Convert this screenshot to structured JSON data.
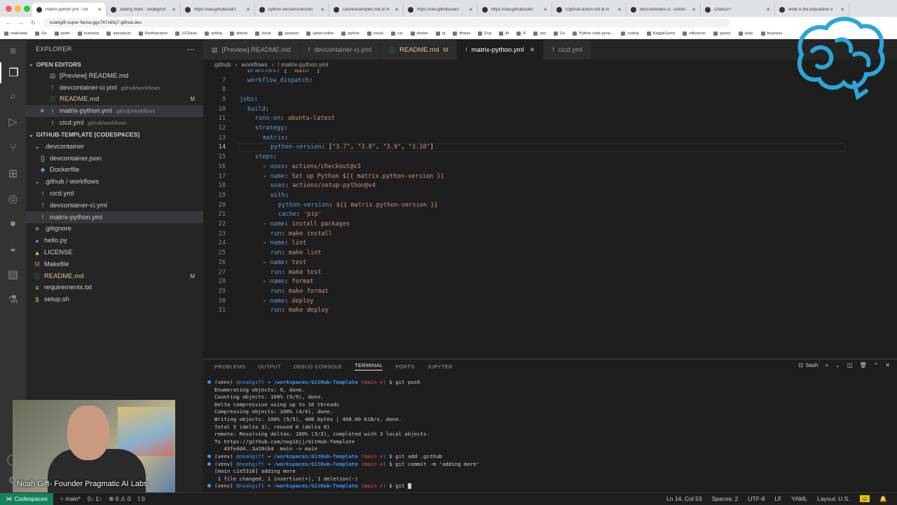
{
  "browser": {
    "tabs": [
      {
        "label": "matrix-python.yml - Git"
      },
      {
        "label": "adding more · noqibjj/Git"
      },
      {
        "label": "https://raw.githubuserc"
      },
      {
        "label": "python-versions/version"
      },
      {
        "label": "cache/examples.md at m"
      },
      {
        "label": "https://raw.githubuserc"
      },
      {
        "label": "https://raw.githubuserc"
      },
      {
        "label": "c/github-action.md at m"
      },
      {
        "label": "devcontainers-ci · Action"
      },
      {
        "label": "ChatGPT"
      },
      {
        "label": "what is the population o"
      }
    ],
    "url": "noahgift-super-fiesta-ggx767x6fxj7.github.dev",
    "bookmarks": [
      "realestate",
      "Go",
      "paiml",
      "business",
      "aiproducts",
      "Northwestern",
      "UCDavis",
      "writing",
      "aibook",
      "cloud",
      "pearson",
      "safari-online",
      "python",
      "social",
      "car",
      "docker",
      "bj",
      "fitness",
      "Eng",
      "AI",
      "R",
      "ops",
      "Go",
      "Python code gene...",
      "coding",
      "KaggleGems",
      "influencer",
      "grants",
      "duke",
      "business"
    ]
  },
  "explorer": {
    "title": "EXPLORER",
    "open_editors_title": "OPEN EDITORS",
    "open_editors": [
      {
        "name": "[Preview] README.md",
        "desc": "",
        "badge": "",
        "icon": "▤",
        "icon_color": "#999"
      },
      {
        "name": "devcontainer-ci.yml",
        "desc": ".github/workflows",
        "badge": "",
        "icon": "!",
        "icon_color": "#cbcb41"
      },
      {
        "name": "README.md",
        "desc": "",
        "badge": "M",
        "icon": "ⓘ",
        "icon_color": "#519aba"
      },
      {
        "name": "matrix-python.yml",
        "desc": ".github/workflows",
        "badge": "",
        "icon": "!",
        "icon_color": "#cbcb41"
      },
      {
        "name": "cicd.yml",
        "desc": ".github/workflows",
        "badge": "",
        "icon": "!",
        "icon_color": "#cbcb41"
      }
    ],
    "workspace_title": "GITHUB-TEMPLATE [CODESPACES]",
    "tree": [
      {
        "name": ".devcontainer",
        "indent": 1,
        "icon": "⌄",
        "icon_color": "#ccc",
        "badge": ""
      },
      {
        "name": "devcontainer.json",
        "indent": 2,
        "icon": "{}",
        "icon_color": "#cbcb41",
        "badge": ""
      },
      {
        "name": "Dockerfile",
        "indent": 2,
        "icon": "◆",
        "icon_color": "#519aba",
        "badge": ""
      },
      {
        "name": ".github / workflows",
        "indent": 1,
        "icon": "⌄",
        "icon_color": "#ccc",
        "badge": ""
      },
      {
        "name": "cicd.yml",
        "indent": 2,
        "icon": "!",
        "icon_color": "#cbcb41",
        "badge": ""
      },
      {
        "name": "devcontainer-ci.yml",
        "indent": 2,
        "icon": "!",
        "icon_color": "#cbcb41",
        "badge": ""
      },
      {
        "name": "matrix-python.yml",
        "indent": 2,
        "icon": "!",
        "icon_color": "#cbcb41",
        "badge": ""
      },
      {
        "name": ".gitignore",
        "indent": 1,
        "icon": "◈",
        "icon_color": "#6d8086",
        "badge": ""
      },
      {
        "name": "hello.py",
        "indent": 1,
        "icon": "●",
        "icon_color": "#519aba",
        "badge": ""
      },
      {
        "name": "LICENSE",
        "indent": 1,
        "icon": "▲",
        "icon_color": "#cbcb41",
        "badge": ""
      },
      {
        "name": "Makefile",
        "indent": 1,
        "icon": "M",
        "icon_color": "#e37933",
        "badge": ""
      },
      {
        "name": "README.md",
        "indent": 1,
        "icon": "ⓘ",
        "icon_color": "#519aba",
        "badge": "M"
      },
      {
        "name": "requirements.txt",
        "indent": 1,
        "icon": "≡",
        "icon_color": "#ccc",
        "badge": ""
      },
      {
        "name": "setup.sh",
        "indent": 1,
        "icon": "$",
        "icon_color": "#cbcb41",
        "badge": ""
      }
    ]
  },
  "editor": {
    "tabs": [
      {
        "label": "[Preview] README.md",
        "icon": "▤",
        "icon_color": "#999",
        "mod": "",
        "close": ""
      },
      {
        "label": "devcontainer-ci.yml",
        "icon": "!",
        "icon_color": "#cbcb41",
        "mod": "",
        "close": ""
      },
      {
        "label": "README.md",
        "icon": "ⓘ",
        "icon_color": "#519aba",
        "mod": "M",
        "close": ""
      },
      {
        "label": "matrix-python.yml",
        "icon": "!",
        "icon_color": "#cbcb41",
        "mod": "",
        "close": "✕"
      },
      {
        "label": "cicd.yml",
        "icon": "!",
        "icon_color": "#cbcb41",
        "mod": "",
        "close": ""
      }
    ],
    "breadcrumb": [
      ".github",
      "workflows",
      "! matrix-python.yml"
    ],
    "current_line": 14,
    "lines": [
      {
        "n": "",
        "indent": 1,
        "parts": [
          [
            "k",
            "branches"
          ],
          [
            "p",
            ": [ "
          ],
          [
            "s",
            "\"main\""
          ],
          [
            "p",
            " ]"
          ]
        ]
      },
      {
        "n": "7",
        "indent": 1,
        "parts": [
          [
            "k",
            "workflow_dispatch"
          ],
          [
            "p",
            ":"
          ]
        ]
      },
      {
        "n": "8",
        "indent": 0,
        "parts": []
      },
      {
        "n": "9",
        "indent": 0,
        "parts": [
          [
            "k",
            "jobs"
          ],
          [
            "p",
            ":"
          ]
        ]
      },
      {
        "n": "10",
        "indent": 1,
        "parts": [
          [
            "k",
            "build"
          ],
          [
            "p",
            ":"
          ]
        ]
      },
      {
        "n": "11",
        "indent": 2,
        "parts": [
          [
            "k",
            "runs-on"
          ],
          [
            "p",
            ": "
          ],
          [
            "s",
            "ubuntu-latest"
          ]
        ]
      },
      {
        "n": "12",
        "indent": 2,
        "parts": [
          [
            "k",
            "strategy"
          ],
          [
            "p",
            ":"
          ]
        ]
      },
      {
        "n": "13",
        "indent": 3,
        "parts": [
          [
            "k",
            "matrix"
          ],
          [
            "p",
            ":"
          ]
        ]
      },
      {
        "n": "14",
        "indent": 4,
        "parts": [
          [
            "k",
            "python-version"
          ],
          [
            "p",
            ": ["
          ],
          [
            "s",
            "\"3.7\""
          ],
          [
            "p",
            ", "
          ],
          [
            "s",
            "\"3.8\""
          ],
          [
            "p",
            ", "
          ],
          [
            "s",
            "\"3.9\""
          ],
          [
            "p",
            ", "
          ],
          [
            "s",
            "\"3.10\""
          ],
          [
            "p",
            "]"
          ]
        ]
      },
      {
        "n": "15",
        "indent": 2,
        "parts": [
          [
            "k",
            "steps"
          ],
          [
            "p",
            ":"
          ]
        ]
      },
      {
        "n": "16",
        "indent": 3,
        "parts": [
          [
            "p",
            "- "
          ],
          [
            "k",
            "uses"
          ],
          [
            "p",
            ": "
          ],
          [
            "s",
            "actions/checkout@v3"
          ]
        ]
      },
      {
        "n": "17",
        "indent": 3,
        "parts": [
          [
            "p",
            "- "
          ],
          [
            "k",
            "name"
          ],
          [
            "p",
            ": "
          ],
          [
            "s",
            "Set up Python ${{ matrix.python-version }}"
          ]
        ]
      },
      {
        "n": "18",
        "indent": 4,
        "parts": [
          [
            "k",
            "uses"
          ],
          [
            "p",
            ": "
          ],
          [
            "s",
            "actions/setup-python@v4"
          ]
        ]
      },
      {
        "n": "19",
        "indent": 4,
        "parts": [
          [
            "k",
            "with"
          ],
          [
            "p",
            ":"
          ]
        ]
      },
      {
        "n": "20",
        "indent": 5,
        "parts": [
          [
            "k",
            "python-version"
          ],
          [
            "p",
            ": "
          ],
          [
            "s",
            "${{ matrix.python-version }}"
          ]
        ]
      },
      {
        "n": "21",
        "indent": 5,
        "parts": [
          [
            "k",
            "cache"
          ],
          [
            "p",
            ": "
          ],
          [
            "s",
            "'pip'"
          ]
        ]
      },
      {
        "n": "22",
        "indent": 3,
        "parts": [
          [
            "p",
            "- "
          ],
          [
            "k",
            "name"
          ],
          [
            "p",
            ": "
          ],
          [
            "s",
            "install packages"
          ]
        ]
      },
      {
        "n": "23",
        "indent": 4,
        "parts": [
          [
            "k",
            "run"
          ],
          [
            "p",
            ": "
          ],
          [
            "s",
            "make install"
          ]
        ]
      },
      {
        "n": "24",
        "indent": 3,
        "parts": [
          [
            "p",
            "- "
          ],
          [
            "k",
            "name"
          ],
          [
            "p",
            ": "
          ],
          [
            "s",
            "lint"
          ]
        ]
      },
      {
        "n": "25",
        "indent": 4,
        "parts": [
          [
            "k",
            "run"
          ],
          [
            "p",
            ": "
          ],
          [
            "s",
            "make lint"
          ]
        ]
      },
      {
        "n": "26",
        "indent": 3,
        "parts": [
          [
            "p",
            "- "
          ],
          [
            "k",
            "name"
          ],
          [
            "p",
            ": "
          ],
          [
            "s",
            "test"
          ]
        ]
      },
      {
        "n": "27",
        "indent": 4,
        "parts": [
          [
            "k",
            "run"
          ],
          [
            "p",
            ": "
          ],
          [
            "s",
            "make test"
          ]
        ]
      },
      {
        "n": "28",
        "indent": 3,
        "parts": [
          [
            "p",
            "- "
          ],
          [
            "k",
            "name"
          ],
          [
            "p",
            ": "
          ],
          [
            "s",
            "format"
          ]
        ]
      },
      {
        "n": "29",
        "indent": 4,
        "parts": [
          [
            "k",
            "run"
          ],
          [
            "p",
            ": "
          ],
          [
            "s",
            "make format"
          ]
        ]
      },
      {
        "n": "30",
        "indent": 3,
        "parts": [
          [
            "p",
            "- "
          ],
          [
            "k",
            "name"
          ],
          [
            "p",
            ": "
          ],
          [
            "s",
            "deploy"
          ]
        ]
      },
      {
        "n": "31",
        "indent": 4,
        "parts": [
          [
            "k",
            "run"
          ],
          [
            "p",
            ": "
          ],
          [
            "s",
            "make deploy"
          ]
        ]
      }
    ]
  },
  "panel": {
    "tabs": [
      "PROBLEMS",
      "OUTPUT",
      "DEBUG CONSOLE",
      "TERMINAL",
      "PORTS",
      "JUPYTER"
    ],
    "active_tab": "TERMINAL",
    "shell": "bash",
    "terminal": [
      {
        "type": "prompt",
        "cmd": "git push"
      },
      {
        "type": "out",
        "text": "Enumerating objects: 9, done."
      },
      {
        "type": "out",
        "text": "Counting objects: 100% (9/9), done."
      },
      {
        "type": "out",
        "text": "Delta compression using up to 16 threads"
      },
      {
        "type": "out",
        "text": "Compressing objects: 100% (4/4), done."
      },
      {
        "type": "out",
        "text": "Writing objects: 100% (5/5), 408 bytes | 408.00 KiB/s, done."
      },
      {
        "type": "out",
        "text": "Total 5 (delta 3), reused 0 (delta 0)"
      },
      {
        "type": "out",
        "text": "remote: Resolving deltas: 100% (3/3), completed with 3 local objects."
      },
      {
        "type": "out",
        "text": "To https://github.com/nogibjj/GitHub-Template"
      },
      {
        "type": "out",
        "text": "   43fe4d4..3a18cb4  main -> main"
      },
      {
        "type": "prompt",
        "cmd": "git add .github"
      },
      {
        "type": "prompt",
        "cmd": "git commit -m 'adding more'"
      },
      {
        "type": "out",
        "text": "[main c1e5316] adding more"
      },
      {
        "type": "out",
        "text": " 1 file changed, 1 insertion(+), 1 deletion(-)"
      },
      {
        "type": "prompt",
        "cmd": "git ",
        "cursor": true
      }
    ],
    "prompt": {
      "venv": "(venv) ",
      "user": "@noahgift",
      "arrow": " → ",
      "path": "/workspaces/GitHub-Template",
      "branch_open": " (",
      "branch": "main",
      "branch_mark": " ✗",
      "branch_close": ") ",
      "dollar": "$ "
    }
  },
  "statusbar": {
    "remote": "Codespaces",
    "branch": "main*",
    "sync": "0↓ 1↑",
    "errors": "⊗ 0 ⚠ 0",
    "ports": "⟟ 0",
    "position": "Ln 14, Col 53",
    "spaces": "Spaces: 2",
    "encoding": "UTF-8",
    "eol": "LF",
    "language": "YAML",
    "layout": "Layout: U.S."
  },
  "overlay": {
    "caption": "Noah Gift- Founder Pragmatic AI Labs",
    "logo_color": "#2aa7d6"
  }
}
